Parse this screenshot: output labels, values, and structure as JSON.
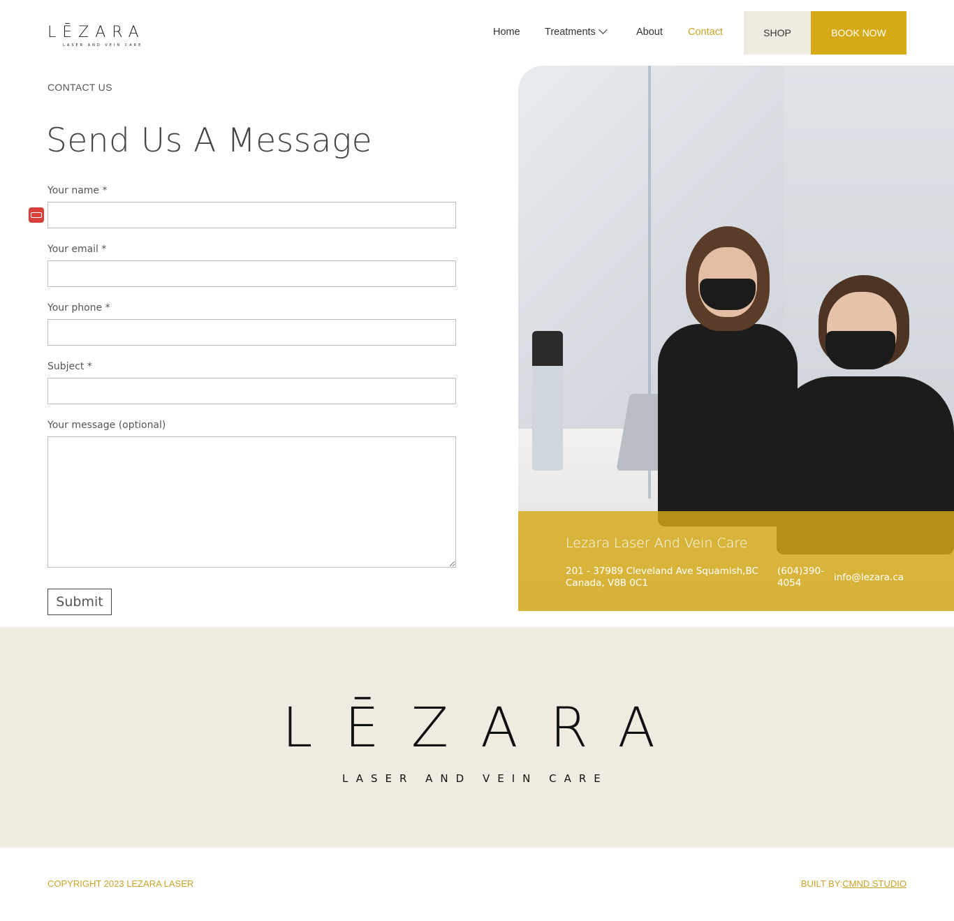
{
  "header": {
    "logo": {
      "word": "LĒZARA",
      "tagline": "LASER AND VEIN CARE"
    },
    "nav": {
      "home": "Home",
      "treatments": "Treatments",
      "about": "About",
      "contact": "Contact"
    },
    "shop_label": "SHOP",
    "book_label": "BOOK NOW"
  },
  "contact": {
    "eyebrow": "CONTACT US",
    "title": "Send Us A Message",
    "fields": {
      "name_label": "Your name *",
      "email_label": "Your email *",
      "phone_label": "Your phone *",
      "subject_label": "Subject *",
      "message_label": "Your message (optional)",
      "name_value": "",
      "email_value": "",
      "phone_value": "",
      "subject_value": "",
      "message_value": ""
    },
    "submit_label": "Submit"
  },
  "info_card": {
    "title": "Lezara Laser And Vein Care",
    "address": "201 - 37989 Cleveland Ave Squamish,BC Canada, V8B 0C1",
    "phone": "(604)390-4054",
    "email": "info@lezara.ca"
  },
  "footer": {
    "logo": {
      "word": "LĒZARA",
      "tagline": "LASER AND VEIN CARE"
    },
    "copyright": "COPYRIGHT 2023 LEZARA LASER",
    "built_by_label": "BUILT BY:",
    "built_by_link": "CMND STUDIO"
  },
  "colors": {
    "accent": "#d6a916",
    "nav_active": "#c9a227",
    "shop_bg": "#efeae0",
    "footer_band": "#efebe1"
  },
  "icons": {
    "treatments_dropdown": "chevron-down-icon",
    "password_manager": "password-manager-icon"
  }
}
